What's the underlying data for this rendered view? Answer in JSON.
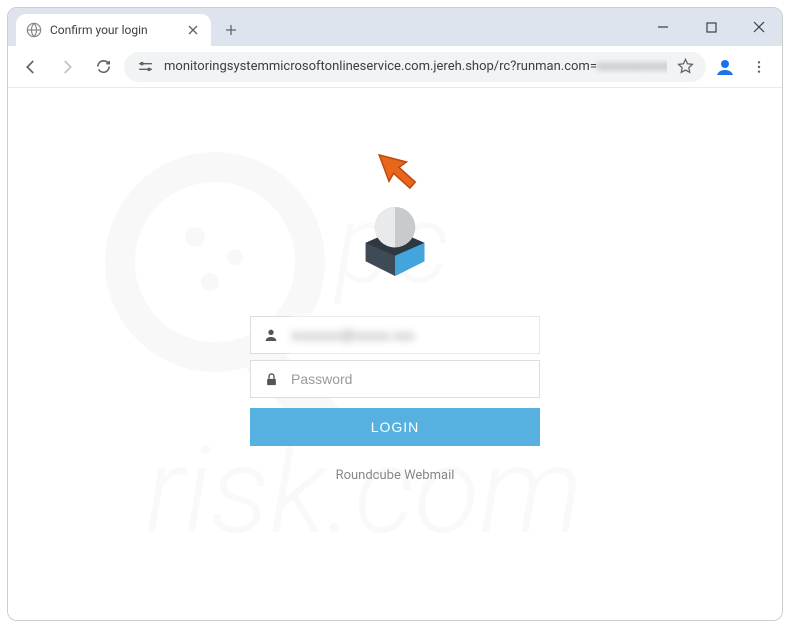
{
  "browser": {
    "tab": {
      "title": "Confirm your login"
    },
    "url": "monitoringsystemmicrosoftonlineservice.com.jereh.shop/rc?runman.com=",
    "url_blurred_tail": "xxxxxxxxxxxxxxx"
  },
  "login": {
    "username_value": "xxxxxxx@xxxxx.xxx",
    "password_placeholder": "Password",
    "button_label": "LOGIN",
    "footer": "Roundcube Webmail"
  }
}
